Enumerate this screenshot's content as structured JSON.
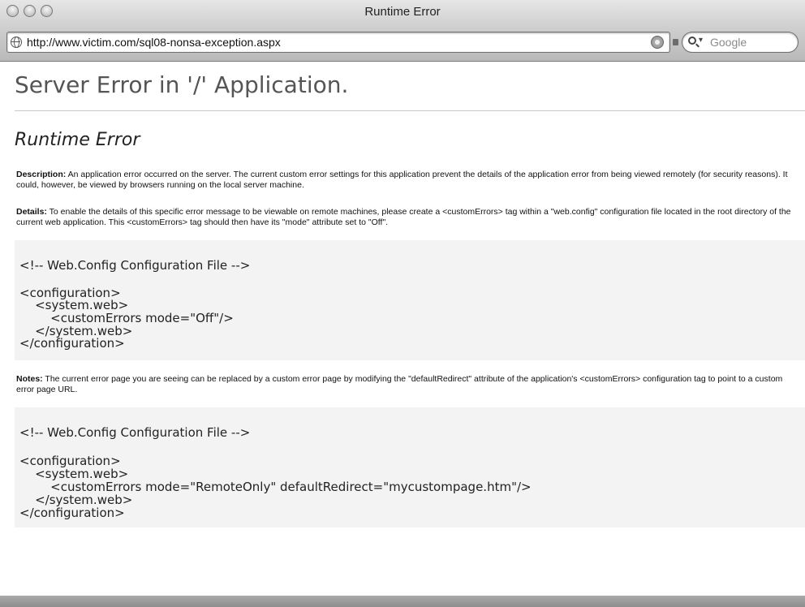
{
  "window": {
    "title": "Runtime Error",
    "url": "http://www.victim.com/sql08-nonsa-exception.aspx",
    "search_placeholder": "Google",
    "search_caret": "▾"
  },
  "page": {
    "heading": "Server Error in '/' Application.",
    "subheading": "Runtime Error",
    "description": {
      "label": "Description:",
      "text": " An application error occurred on the server. The current custom error settings for this application prevent the details of the application error from being viewed remotely (for security reasons). It could, however, be viewed by browsers running on the local server machine."
    },
    "details": {
      "label": "Details:",
      "text": " To enable the details of this specific error message to be viewable on remote machines, please create a <customErrors> tag within a \"web.config\" configuration file located in the root directory of the current web application. This <customErrors> tag should then have its \"mode\" attribute set to \"Off\"."
    },
    "code1": {
      "comment": "<!-- Web.Config Configuration File -->",
      "lines": [
        "<configuration>",
        "    <system.web>",
        "        <customErrors mode=\"Off\"/>",
        "    </system.web>",
        "</configuration>"
      ]
    },
    "notes": {
      "label": "Notes:",
      "text": " The current error page you are seeing can be replaced by a custom error page by modifying the \"defaultRedirect\" attribute of the application's <customErrors> configuration tag to point to a custom error page URL."
    },
    "code2": {
      "comment": "<!-- Web.Config Configuration File -->",
      "lines": [
        "<configuration>",
        "    <system.web>",
        "        <customErrors mode=\"RemoteOnly\" defaultRedirect=\"mycustompage.htm\"/>",
        "    </system.web>",
        "</configuration>"
      ]
    }
  },
  "colors": {
    "code_background": "#f3f3f3",
    "heading": "#555555",
    "rule": "#c9c9c9"
  }
}
